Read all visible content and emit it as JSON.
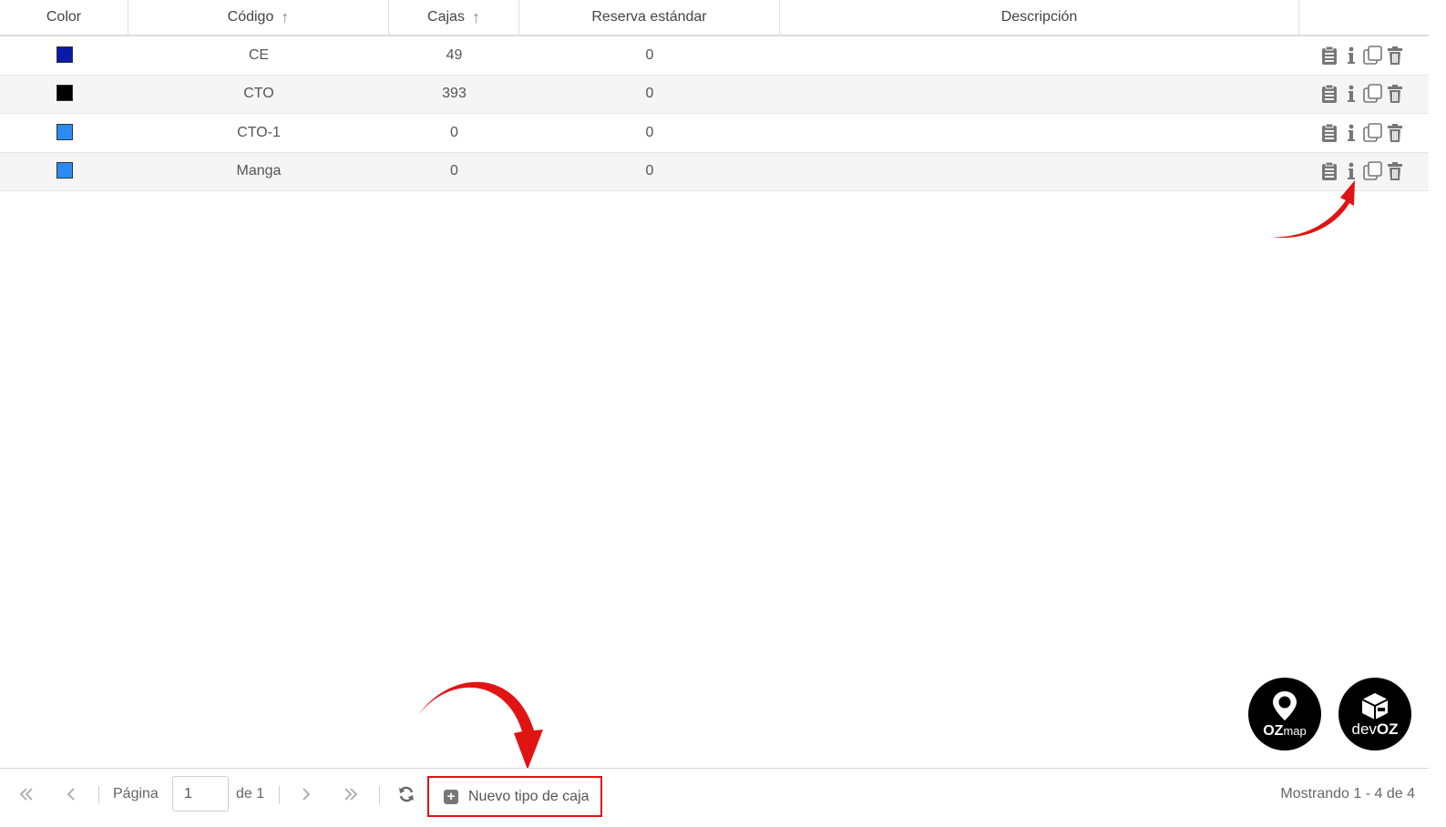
{
  "table": {
    "columns": [
      {
        "label": "Color"
      },
      {
        "label": "Código",
        "sort_icon": "sort-up-arrow-icon"
      },
      {
        "label": "Cajas",
        "sort_icon": "sort-up-arrow-icon"
      },
      {
        "label": "Reserva estándar"
      },
      {
        "label": "Descripción"
      },
      {
        "label": ""
      }
    ],
    "rows": [
      {
        "color": "#0a1aa8",
        "code": "CE",
        "boxes": "49",
        "reserve": "0",
        "description": ""
      },
      {
        "color": "#000000",
        "code": "CTO",
        "boxes": "393",
        "reserve": "0",
        "description": ""
      },
      {
        "color": "#2a8cf0",
        "code": "CTO-1",
        "boxes": "0",
        "reserve": "0",
        "description": ""
      },
      {
        "color": "#2a8cf0",
        "code": "Manga",
        "boxes": "0",
        "reserve": "0",
        "description": ""
      }
    ],
    "row_actions": [
      "clipboard-icon",
      "info-icon",
      "duplicate-icon",
      "trash-icon"
    ]
  },
  "pager": {
    "page_label": "Página",
    "page_value": "1",
    "of_label": "de 1",
    "new_button_label": "Nuevo tipo de caja",
    "showing_text": "Mostrando 1 - 4 de 4"
  },
  "logos": {
    "ozmap_bold": "OZ",
    "ozmap_light": "map",
    "devoz_light": "dev",
    "devoz_bold": "OZ"
  },
  "colors": {
    "annotation_red": "#e11414",
    "icon_gray": "#777777",
    "alt_row": "#f5f5f5"
  }
}
